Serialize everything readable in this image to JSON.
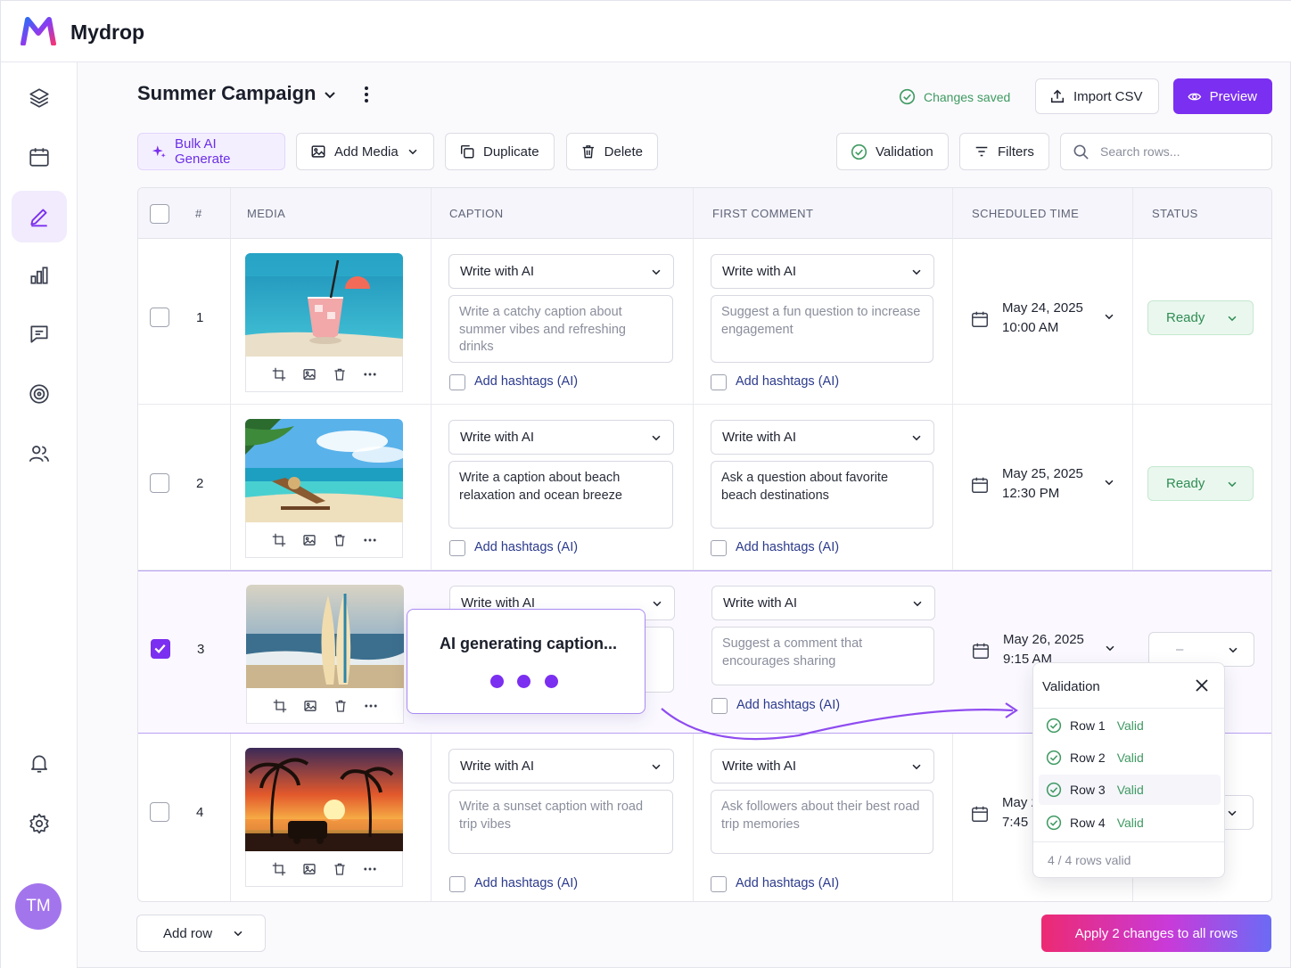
{
  "app": {
    "name": "Mydrop",
    "avatar_initials": "TM"
  },
  "sidebar": {
    "items": [
      {
        "icon": "layers-icon"
      },
      {
        "icon": "calendar-icon"
      },
      {
        "icon": "edit-icon",
        "active": true
      },
      {
        "icon": "analytics-icon"
      },
      {
        "icon": "messages-icon"
      },
      {
        "icon": "target-icon"
      },
      {
        "icon": "users-icon"
      },
      {
        "icon": "bell-icon"
      },
      {
        "icon": "settings-icon"
      }
    ]
  },
  "header": {
    "title": "Summer Campaign",
    "saved_status": "Changes saved",
    "import_label": "Import CSV",
    "preview_label": "Preview"
  },
  "toolbar": {
    "bulk_ai_label": "Bulk AI Generate",
    "add_media_label": "Add Media",
    "duplicate_label": "Duplicate",
    "delete_label": "Delete",
    "validation_label": "Validation",
    "filters_label": "Filters",
    "search_placeholder": "Search rows..."
  },
  "table": {
    "columns": [
      "#",
      "MEDIA",
      "CAPTION",
      "FIRST COMMENT",
      "SCHEDULED TIME",
      "STATUS"
    ],
    "rows": [
      {
        "num": "1",
        "checked": false,
        "caption_mode": "Write with AI",
        "caption_text": "Write a catchy caption about summer vibes and refreshing drinks",
        "comment_mode": "Write with AI",
        "comment_text": "Suggest a fun question to increase engagement",
        "hashtags_label": "Add hashtags (AI)",
        "date": "May 24, 2025",
        "time": "10:00 AM",
        "status": "Ready"
      },
      {
        "num": "2",
        "checked": false,
        "caption_mode": "Write with AI",
        "caption_text": "Write a caption about beach relaxation and ocean breeze",
        "comment_mode": "Write with AI",
        "comment_text": "Ask a question about favorite beach destinations",
        "hashtags_label": "Add hashtags (AI)",
        "date": "May 25, 2025",
        "time": "12:30 PM",
        "status": "Ready"
      },
      {
        "num": "3",
        "checked": true,
        "caption_mode": "Write with AI",
        "caption_text": "",
        "comment_mode": "Write with AI",
        "comment_text": "Suggest a comment that encourages sharing",
        "hashtags_label": "Add hashtags (AI)",
        "date": "May 26, 2025",
        "time": "9:15 AM",
        "status": "–"
      },
      {
        "num": "4",
        "checked": false,
        "caption_mode": "Write with AI",
        "caption_text": "Write a sunset caption with road trip vibes",
        "comment_mode": "Write with AI",
        "comment_text": "Ask followers about their best road trip memories",
        "hashtags_label": "Add hashtags (AI)",
        "date": "May 2",
        "time": "7:45 P",
        "status": ""
      }
    ]
  },
  "ai_popup": {
    "text": "AI generating caption..."
  },
  "validation_popup": {
    "title": "Validation",
    "rows": [
      {
        "label": "Row 1",
        "state": "Valid"
      },
      {
        "label": "Row 2",
        "state": "Valid"
      },
      {
        "label": "Row 3",
        "state": "Valid"
      },
      {
        "label": "Row 4",
        "state": "Valid"
      }
    ],
    "summary": "4 / 4 rows valid"
  },
  "footer": {
    "add_row_label": "Add row",
    "apply_label": "Apply 2 changes to all rows"
  },
  "colors": {
    "accent": "#7b2ff0",
    "success": "#3f9a62",
    "ready_bg": "#eaf7ee"
  }
}
